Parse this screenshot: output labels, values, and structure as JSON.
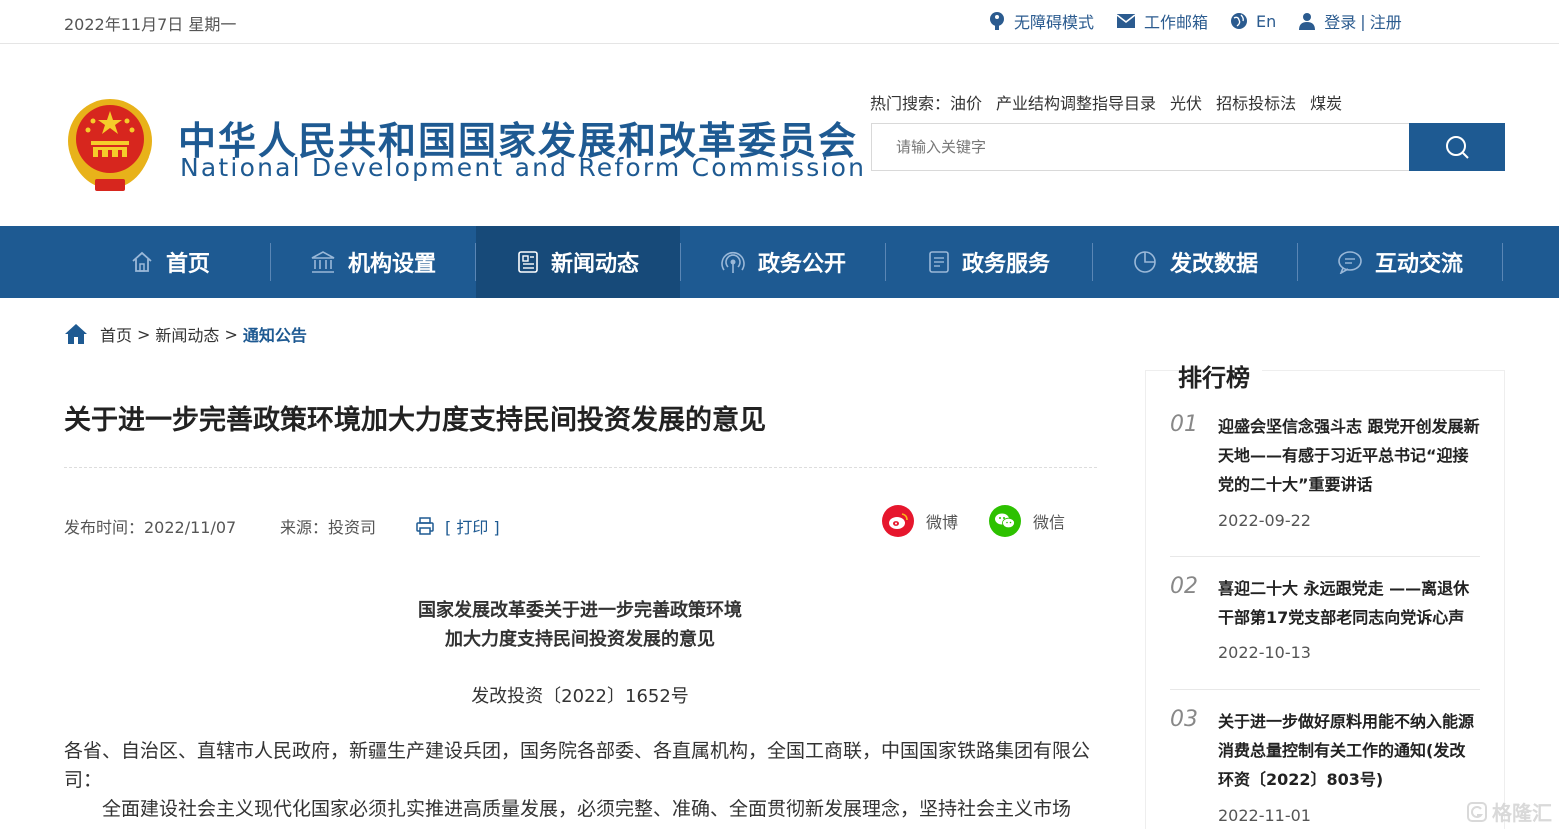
{
  "topbar": {
    "date": "2022年11月7日 星期一",
    "accessibility": "无障碍模式",
    "mail": "工作邮箱",
    "lang": "En",
    "login": "登录",
    "sep": "|",
    "register": "注册"
  },
  "header": {
    "title_cn": "中华人民共和国国家发展和改革委员会",
    "title_en": "National Development and Reform Commission",
    "hot_label": "热门搜索：",
    "hot_terms": [
      "油价",
      "产业结构调整指导目录",
      "光伏",
      "招标投标法",
      "煤炭"
    ],
    "search_placeholder": "请输入关键字"
  },
  "nav": {
    "items": [
      {
        "label": "首页",
        "icon": "home-icon"
      },
      {
        "label": "机构设置",
        "icon": "institution-icon"
      },
      {
        "label": "新闻动态",
        "icon": "news-icon"
      },
      {
        "label": "政务公开",
        "icon": "broadcast-icon"
      },
      {
        "label": "政务服务",
        "icon": "document-icon"
      },
      {
        "label": "发改数据",
        "icon": "pie-chart-icon"
      },
      {
        "label": "互动交流",
        "icon": "chat-icon"
      }
    ]
  },
  "breadcrumb": {
    "home": "首页",
    "gt": ">",
    "level2": "新闻动态",
    "current": "通知公告"
  },
  "article": {
    "title": "关于进一步完善政策环境加大力度支持民间投资发展的意见",
    "publish_time": "发布时间：2022/11/07",
    "source": "来源：投资司",
    "print": "[ 打印 ]",
    "share_weibo": "微博",
    "share_wechat": "微信",
    "doc_heading_1": "国家发展改革委关于进一步完善政策环境",
    "doc_heading_2": "加大力度支持民间投资发展的意见",
    "doc_number": "发改投资〔2022〕1652号",
    "recipients": "各省、自治区、直辖市人民政府，新疆生产建设兵团，国务院各部委、各直属机构，全国工商联，中国国家铁路集团有限公司：",
    "body_1": "全面建设社会主义现代化国家必须扎实推进高质量发展，必须完整、准确、全面贯彻新发展理念，坚持社会主义市场"
  },
  "sidebar": {
    "title": "排行榜",
    "items": [
      {
        "num": "01",
        "title": "迎盛会坚信念强斗志 跟党开创发展新天地——有感于习近平总书记“迎接党的二十大”重要讲话",
        "date": "2022-09-22"
      },
      {
        "num": "02",
        "title": "喜迎二十大 永远跟党走 ——离退休干部第17党支部老同志向党诉心声",
        "date": "2022-10-13"
      },
      {
        "num": "03",
        "title": "关于进一步做好原料用能不纳入能源消费总量控制有关工作的通知(发改环资〔2022〕803号)",
        "date": "2022-11-01"
      }
    ]
  },
  "watermark": "格隆汇",
  "colors": {
    "brand": "#1e5a92",
    "nav_active": "#174a79",
    "weibo": "#e6162d",
    "wechat": "#2dc100"
  }
}
